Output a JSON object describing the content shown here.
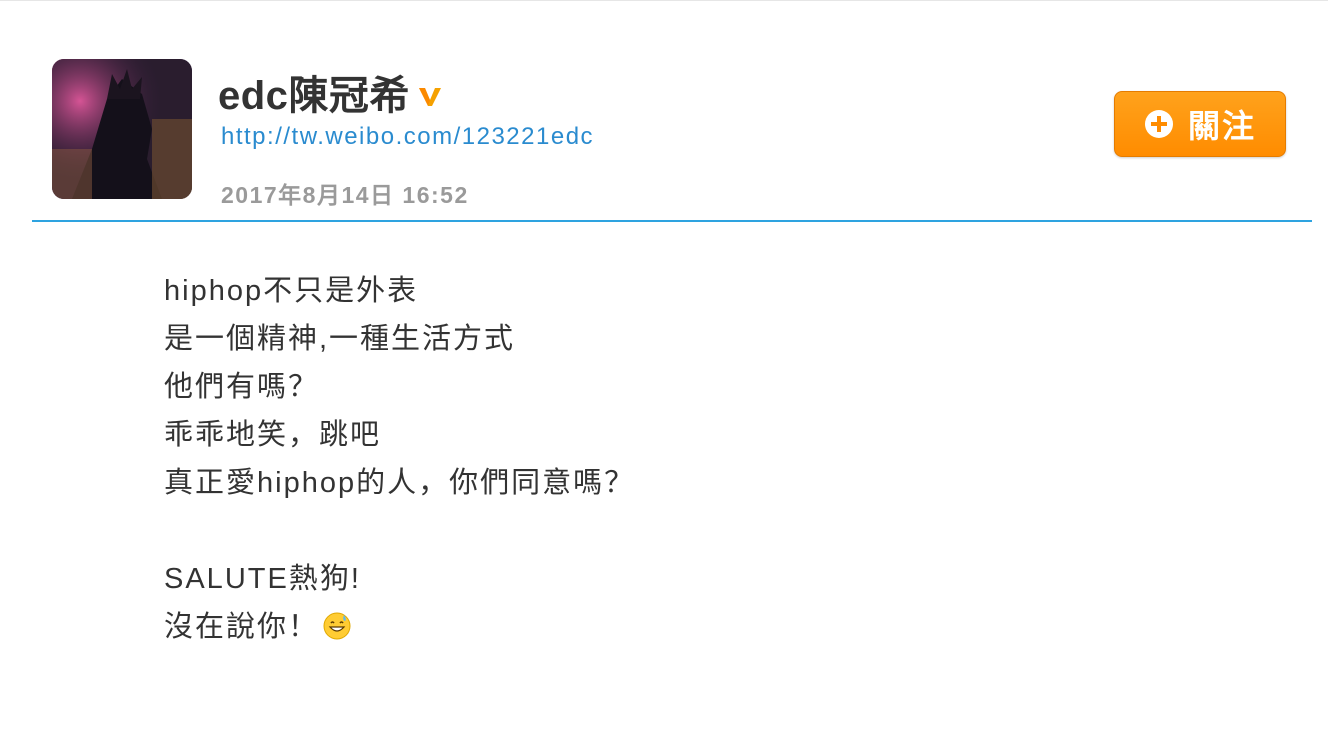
{
  "profile": {
    "name": "edc陳冠希",
    "url": "http://tw.weibo.com/123221edc",
    "timestamp": "2017年8月14日 16:52"
  },
  "icons": {
    "verified": "verified-v-icon",
    "follow": "plus-circle-icon",
    "emoji": "grinning-sweat-emoji-icon"
  },
  "follow_button": {
    "label": "關注"
  },
  "post": {
    "lines": [
      "hiphop不只是外表",
      "是一個精神,一種生活方式",
      "他們有嗎？",
      "乖乖地笑，跳吧",
      "真正愛hiphop的人，你們同意嗎？",
      "",
      "SALUTE熱狗!",
      "沒在說你！"
    ]
  },
  "colors": {
    "accent": "#2ea3e0",
    "link": "#2a8bcf",
    "follow_button": "#ff8c00",
    "verified": "#f5a100",
    "text": "#333333",
    "muted": "#9a9a9a"
  }
}
